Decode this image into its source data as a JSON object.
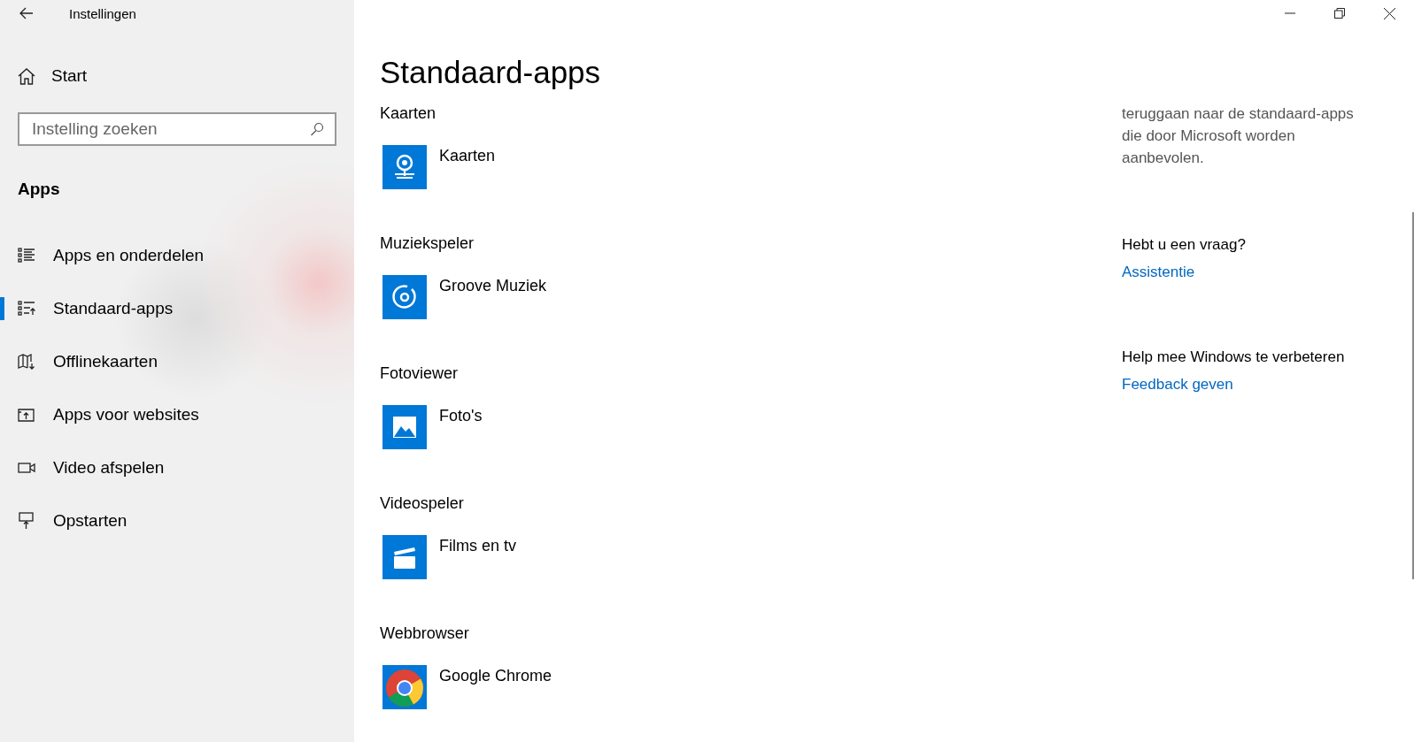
{
  "window": {
    "title": "Instellingen"
  },
  "sidebar": {
    "home": "Start",
    "search": {
      "placeholder": "Instelling zoeken"
    },
    "section": "Apps",
    "items": [
      {
        "label": "Apps en onderdelen",
        "selected": false
      },
      {
        "label": "Standaard-apps",
        "selected": true
      },
      {
        "label": "Offlinekaarten",
        "selected": false
      },
      {
        "label": "Apps voor websites",
        "selected": false
      },
      {
        "label": "Video afspelen",
        "selected": false
      },
      {
        "label": "Opstarten",
        "selected": false
      }
    ]
  },
  "page": {
    "title": "Standaard-apps",
    "defaults": [
      {
        "category": "Kaarten",
        "app": "Kaarten"
      },
      {
        "category": "Muziekspeler",
        "app": "Groove Muziek"
      },
      {
        "category": "Fotoviewer",
        "app": "Foto's"
      },
      {
        "category": "Videospeler",
        "app": "Films en tv"
      },
      {
        "category": "Webbrowser",
        "app": "Google Chrome"
      }
    ]
  },
  "aside": {
    "text": "teruggaan naar de standaard-apps die door Microsoft worden aanbevolen.",
    "sections": [
      {
        "heading": "Hebt u een vraag?",
        "link": "Assistentie"
      },
      {
        "heading": "Help mee Windows te verbeteren",
        "link": "Feedback geven"
      }
    ]
  }
}
